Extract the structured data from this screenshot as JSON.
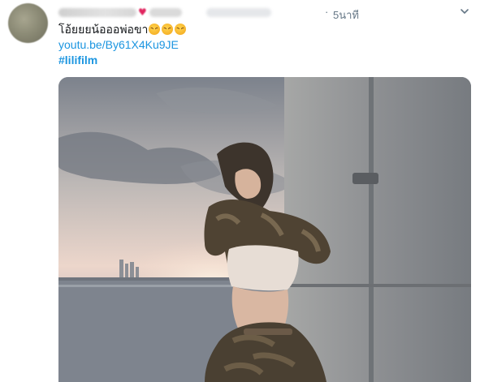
{
  "tweet": {
    "timestamp": "5นาที",
    "text": "โอ้ยยยน้อออพ่อขา",
    "emojis": [
      "persevere-face-icon",
      "persevere-face-icon",
      "persevere-face-icon"
    ],
    "link": "youtu.be/By61X4Ku9JE",
    "hashtag": "#lilifilm"
  },
  "colors": {
    "link": "#1b95e0",
    "muted": "#657786",
    "heart": "#e0245e"
  }
}
